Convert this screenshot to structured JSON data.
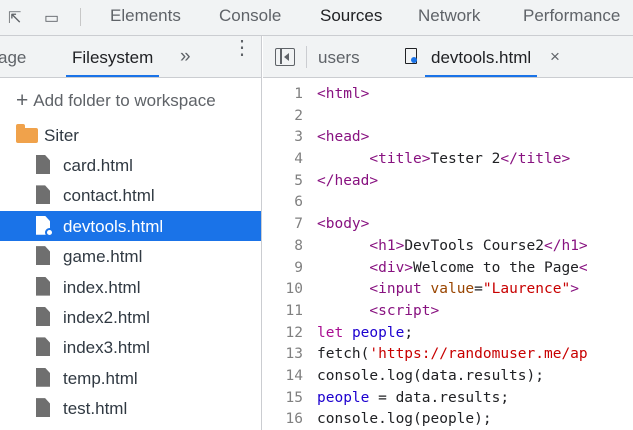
{
  "toolbar": {
    "tabs": [
      "Elements",
      "Console",
      "Sources",
      "Network",
      "Performance"
    ],
    "active_tab": "Sources"
  },
  "navigator": {
    "tabs": [
      "age",
      "Filesystem"
    ],
    "active_tab": "Filesystem",
    "more_label": "»",
    "kebab_label": "⋮",
    "add_folder_label": "Add folder to workspace",
    "folder": "Siter",
    "files": [
      "card.html",
      "contact.html",
      "devtools.html",
      "game.html",
      "index.html",
      "index2.html",
      "index3.html",
      "temp.html",
      "test.html"
    ],
    "selected_file": "devtools.html"
  },
  "editor": {
    "tabs": [
      "users",
      "devtools.html"
    ],
    "active_tab": "devtools.html",
    "close_label": "×",
    "lines": [
      {
        "n": "1",
        "html": "<span class=\"tag\">&lt;html&gt;</span>"
      },
      {
        "n": "2",
        "html": ""
      },
      {
        "n": "3",
        "html": "<span class=\"tag\">&lt;head&gt;</span>"
      },
      {
        "n": "4",
        "html": "      <span class=\"tag\">&lt;title&gt;</span>Tester 2<span class=\"tag\">&lt;/title&gt;</span>"
      },
      {
        "n": "5",
        "html": "<span class=\"tag\">&lt;/head&gt;</span>"
      },
      {
        "n": "6",
        "html": ""
      },
      {
        "n": "7",
        "html": "<span class=\"tag\">&lt;body&gt;</span>"
      },
      {
        "n": "8",
        "html": "      <span class=\"tag\">&lt;h1&gt;</span>DevTools Course2<span class=\"tag\">&lt;/h1&gt;</span>"
      },
      {
        "n": "9",
        "html": "      <span class=\"tag\">&lt;div&gt;</span>Welcome to the Page<span class=\"tag\">&lt;</span>"
      },
      {
        "n": "10",
        "html": "      <span class=\"tag\">&lt;input</span> <span class=\"attr\">value</span>=<span class=\"str\">\"Laurence\"</span><span class=\"tag\">&gt;</span>"
      },
      {
        "n": "11",
        "html": "      <span class=\"tag\">&lt;script&gt;</span>"
      },
      {
        "n": "12",
        "html": "<span class=\"kw\">let</span> <span class=\"var\">people</span>;"
      },
      {
        "n": "13",
        "html": "fetch(<span class=\"str\">'https://randomuser.me/ap</span>"
      },
      {
        "n": "14",
        "html": "console.log(data.results);"
      },
      {
        "n": "15",
        "html": "<span class=\"var\">people</span> = data.results;"
      },
      {
        "n": "16",
        "html": "console.log(people);"
      }
    ]
  },
  "colors": {
    "accent": "#1a73e8",
    "folder": "#f0a24b",
    "tag": "#881280",
    "string": "#c80000"
  }
}
